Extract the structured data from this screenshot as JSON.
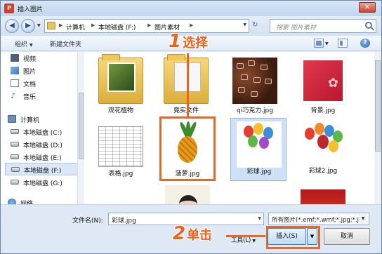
{
  "window": {
    "app_icon_text": "P",
    "title": "插入图片",
    "close_glyph": "✕"
  },
  "nav": {
    "back_glyph": "◀",
    "forward_glyph": "▶",
    "breadcrumbs": [
      "计算机",
      "本地磁盘 (F:)",
      "图片素材"
    ],
    "refresh_glyph": "↻",
    "search_placeholder": "搜索 图片素材"
  },
  "toolbar": {
    "organize": "组织",
    "new_folder": "新建文件夹",
    "help": "?"
  },
  "sidebar": {
    "items": [
      {
        "label": "视频",
        "icon": "video-icon"
      },
      {
        "label": "图片",
        "icon": "pictures-icon"
      },
      {
        "label": "文档",
        "icon": "documents-icon"
      },
      {
        "label": "音乐",
        "icon": "music-icon"
      },
      {
        "label": "计算机",
        "icon": "computer-icon"
      },
      {
        "label": "本地磁盘 (C:)",
        "icon": "drive-icon"
      },
      {
        "label": "本地磁盘 (D:)",
        "icon": "drive-icon"
      },
      {
        "label": "本地磁盘 (E:)",
        "icon": "drive-icon"
      },
      {
        "label": "本地磁盘 (F:)",
        "icon": "drive-icon",
        "selected": true
      },
      {
        "label": "本地磁盘 (G:)",
        "icon": "drive-icon"
      },
      {
        "label": "网络",
        "icon": "network-icon"
      }
    ]
  },
  "files": [
    {
      "name": "观花植物",
      "kind": "folder"
    },
    {
      "name": "竟实文件",
      "kind": "folder"
    },
    {
      "name": "qi巧克力.jpg",
      "kind": "image"
    },
    {
      "name": "背景.jpg",
      "kind": "image"
    },
    {
      "name": "表格.jpg",
      "kind": "image"
    },
    {
      "name": "菠萝.jpg",
      "kind": "image",
      "highlighted": true
    },
    {
      "name": "彩球.jpg",
      "kind": "image",
      "selected": true
    },
    {
      "name": "彩球2.jpg",
      "kind": "image"
    },
    {
      "name": "",
      "kind": "image"
    },
    {
      "name": "",
      "kind": "image"
    }
  ],
  "bottom": {
    "filename_label": "文件名(N):",
    "filename_value": "彩球.jpg",
    "filetype_value": "所有图片(*.emf;*.wmf;*.jpg;*.ji",
    "tools_label": "工具(L)",
    "insert_label": "插入(S)",
    "cancel_label": "取消"
  },
  "annotations": {
    "step1_number": "1",
    "step1_text": "选择",
    "step2_number": "2",
    "step2_text": "单击",
    "color": "#e8651f"
  }
}
